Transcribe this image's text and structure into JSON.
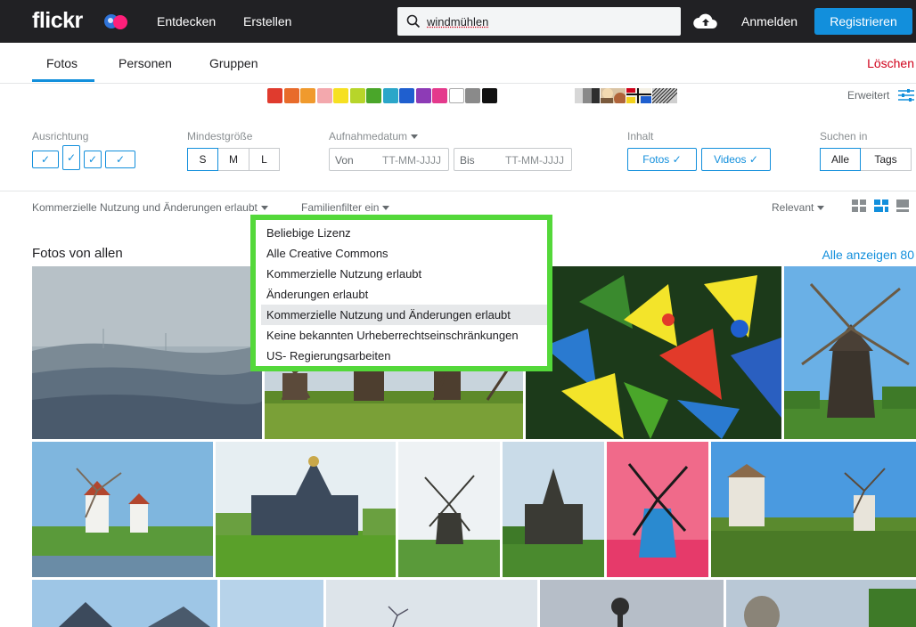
{
  "header": {
    "logo_text": "flickr",
    "nav": [
      "Entdecken",
      "Erstellen"
    ],
    "search_value": "windmühlen",
    "signin_label": "Anmelden",
    "register_label": "Registrieren"
  },
  "tabs": {
    "items": [
      "Fotos",
      "Personen",
      "Gruppen"
    ],
    "active": "Fotos",
    "clear_label": "Löschen"
  },
  "colors": [
    "#e03b2e",
    "#e86b2b",
    "#f09a2d",
    "#f3a8ad",
    "#f6e022",
    "#b7d52a",
    "#4aa62a",
    "#2ba6c9",
    "#1f5fcf",
    "#8d3bb6",
    "#e43a8c",
    "#ffffff",
    "#8a8a8a",
    "#111111"
  ],
  "advanced_label": "Erweitert",
  "filters": {
    "orientation_label": "Ausrichtung",
    "min_size_label": "Mindestgröße",
    "sizes": [
      "S",
      "M",
      "L"
    ],
    "date_label": "Aufnahmedatum",
    "from_label": "Von",
    "to_label": "Bis",
    "date_placeholder": "TT-MM-JJJJ",
    "content_label": "Inhalt",
    "content_photos": "Fotos ✓",
    "content_videos": "Videos ✓",
    "search_in_label": "Suchen in",
    "search_in_all": "Alle",
    "search_in_tags": "Tags"
  },
  "license_bar": {
    "license_label": "Kommerzielle Nutzung und Änderungen erlaubt",
    "family_label": "Familienfilter ein",
    "sort_label": "Relevant"
  },
  "license_dropdown": {
    "options": [
      "Beliebige Lizenz",
      "Alle Creative Commons",
      "Kommerzielle Nutzung erlaubt",
      "Änderungen erlaubt",
      "Kommerzielle Nutzung und Änderungen erlaubt",
      "Keine bekannten Urheberrechtseinschränkungen",
      "US- Regierungsarbeiten"
    ],
    "selected_index": 4,
    "highlight_color": "#54d83a"
  },
  "gallery": {
    "title": "Fotos von allen",
    "see_all_label": "Alle anzeigen 80"
  }
}
